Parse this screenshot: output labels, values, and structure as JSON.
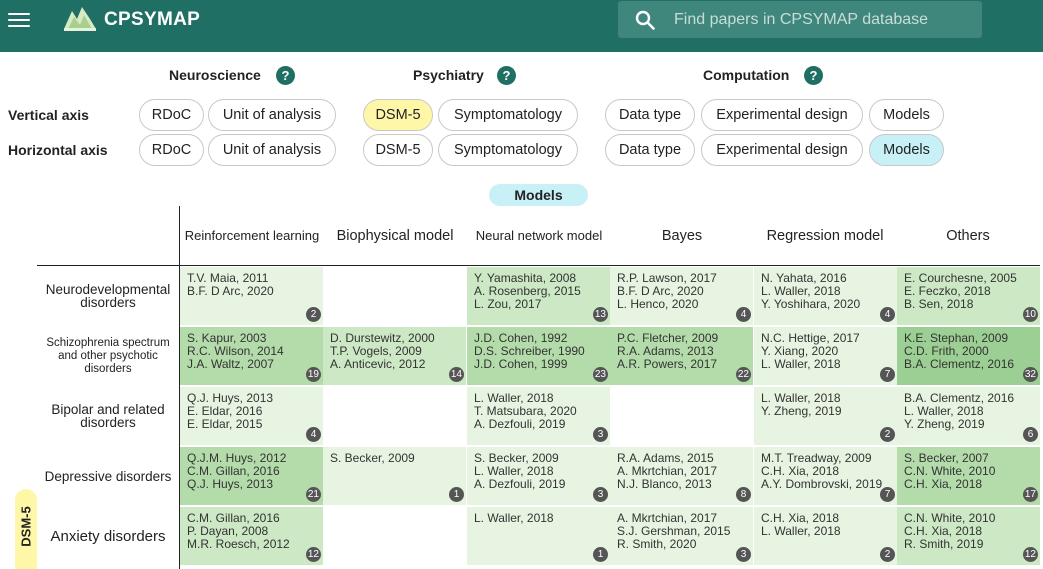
{
  "app": {
    "brand": "CPSYMAP",
    "search_placeholder": "Find papers in CPSYMAP database",
    "icons": [
      "menu-icon",
      "logo-icon",
      "search-icon",
      "help-icon"
    ]
  },
  "colors": {
    "header": "#1f6f64",
    "selected_vertical": "#fff7a8",
    "selected_horizontal": "#c7f1f7"
  },
  "sections": {
    "neuroscience": "Neuroscience",
    "psychiatry": "Psychiatry",
    "computation": "Computation",
    "help": "?"
  },
  "axes": {
    "vertical": "Vertical axis",
    "horizontal": "Horizontal axis"
  },
  "chips": {
    "rdoc": "RDoC",
    "unit": "Unit of analysis",
    "dsm": "DSM-5",
    "symptom": "Symptomatology",
    "datatype": "Data type",
    "expdesign": "Experimental design",
    "models": "Models"
  },
  "selection": {
    "vertical": "DSM-5",
    "horizontal": "Models"
  },
  "matrix": {
    "horizontal_title": "Models",
    "vertical_title": "DSM-5",
    "columns": [
      "Reinforcement learning",
      "Biophysical model",
      "Neural network model",
      "Bayes",
      "Regression model",
      "Others"
    ],
    "rows": [
      {
        "label": "Neurodevelopmental disorders",
        "cells": [
          {
            "refs": [
              "T.V. Maia, 2011",
              "B.F. D Arc, 2020"
            ],
            "count": "2"
          },
          {
            "refs": [],
            "count": ""
          },
          {
            "refs": [
              "Y. Yamashita, 2008",
              "A. Rosenberg, 2015",
              "L. Zou, 2017"
            ],
            "count": "13"
          },
          {
            "refs": [
              "R.P. Lawson, 2017",
              "B.F. D Arc, 2020",
              "L. Henco, 2020"
            ],
            "count": "4"
          },
          {
            "refs": [
              "N. Yahata, 2016",
              "L. Waller, 2018",
              "Y. Yoshihara, 2020"
            ],
            "count": "4"
          },
          {
            "refs": [
              "E. Courchesne, 2005",
              "E. Feczko, 2018",
              "B. Sen, 2018"
            ],
            "count": "10"
          }
        ]
      },
      {
        "label": "Schizophrenia spectrum and other psychotic disorders",
        "cells": [
          {
            "refs": [
              "S. Kapur, 2003",
              "R.C. Wilson, 2014",
              "J.A. Waltz, 2007"
            ],
            "count": "19"
          },
          {
            "refs": [
              "D. Durstewitz, 2000",
              "T.P. Vogels, 2009",
              "A. Anticevic, 2012"
            ],
            "count": "14"
          },
          {
            "refs": [
              "J.D. Cohen, 1992",
              "D.S. Schreiber, 1990",
              "J.D. Cohen, 1999"
            ],
            "count": "23"
          },
          {
            "refs": [
              "P.C. Fletcher, 2009",
              "R.A. Adams, 2013",
              "A.R. Powers, 2017"
            ],
            "count": "22"
          },
          {
            "refs": [
              "N.C. Hettige, 2017",
              "Y. Xiang, 2020",
              "L. Waller, 2018"
            ],
            "count": "7"
          },
          {
            "refs": [
              "K.E. Stephan, 2009",
              "C.D. Frith, 2000",
              "B.A. Clementz, 2016"
            ],
            "count": "32"
          }
        ]
      },
      {
        "label": "Bipolar and related disorders",
        "cells": [
          {
            "refs": [
              "Q.J. Huys, 2013",
              "E. Eldar, 2016",
              "E. Eldar, 2015"
            ],
            "count": "4"
          },
          {
            "refs": [],
            "count": ""
          },
          {
            "refs": [
              "L. Waller, 2018",
              "T. Matsubara, 2020",
              "A. Dezfouli, 2019"
            ],
            "count": "3"
          },
          {
            "refs": [],
            "count": ""
          },
          {
            "refs": [
              "L. Waller, 2018",
              "Y. Zheng, 2019"
            ],
            "count": "2"
          },
          {
            "refs": [
              "B.A. Clementz, 2016",
              "L. Waller, 2018",
              "Y. Zheng, 2019"
            ],
            "count": "6"
          }
        ]
      },
      {
        "label": "Depressive disorders",
        "cells": [
          {
            "refs": [
              "Q.J.M. Huys, 2012",
              "C.M. Gillan, 2016",
              "Q.J. Huys, 2013"
            ],
            "count": "21"
          },
          {
            "refs": [
              "S. Becker, 2009"
            ],
            "count": "1"
          },
          {
            "refs": [
              "S. Becker, 2009",
              "L. Waller, 2018",
              "A. Dezfouli, 2019"
            ],
            "count": "3"
          },
          {
            "refs": [
              "R.A. Adams, 2015",
              "A. Mkrtchian, 2017",
              "N.J. Blanco, 2013"
            ],
            "count": "8"
          },
          {
            "refs": [
              "M.T. Treadway, 2009",
              "C.H. Xia, 2018",
              "A.Y. Dombrovski, 2019"
            ],
            "count": "7"
          },
          {
            "refs": [
              "S. Becker, 2007",
              "C.N. White, 2010",
              "C.H. Xia, 2018"
            ],
            "count": "17"
          }
        ]
      },
      {
        "label": "Anxiety disorders",
        "cells": [
          {
            "refs": [
              "C.M. Gillan, 2016",
              "P. Dayan, 2008",
              "M.R. Roesch, 2012"
            ],
            "count": "12"
          },
          {
            "refs": [],
            "count": ""
          },
          {
            "refs": [
              "L. Waller, 2018"
            ],
            "count": "1"
          },
          {
            "refs": [
              "A. Mkrtchian, 2017",
              "S.J. Gershman, 2015",
              "R. Smith, 2020"
            ],
            "count": "3"
          },
          {
            "refs": [
              "C.H. Xia, 2018",
              "L. Waller, 2018"
            ],
            "count": "2"
          },
          {
            "refs": [
              "C.N. White, 2010",
              "C.H. Xia, 2018",
              "R. Smith, 2019"
            ],
            "count": "12"
          }
        ]
      }
    ]
  }
}
